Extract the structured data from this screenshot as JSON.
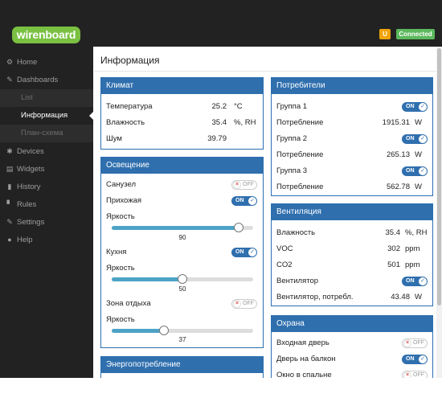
{
  "brand": {
    "logo": "wirenboard"
  },
  "status": {
    "user_badge": "U",
    "connection": "Connected"
  },
  "sidebar": {
    "items": [
      {
        "label": "Home",
        "icon": "home-icon"
      },
      {
        "label": "Dashboards",
        "icon": "wrench-icon"
      },
      {
        "label": "List",
        "sub": true
      },
      {
        "label": "Информация",
        "sub": true,
        "active": true
      },
      {
        "label": "План-схема",
        "sub": true
      },
      {
        "label": "Devices",
        "icon": "gear-icon"
      },
      {
        "label": "Widgets",
        "icon": "widgets-icon"
      },
      {
        "label": "History",
        "icon": "bar-chart-icon"
      },
      {
        "label": "Rules",
        "icon": "file-icon"
      },
      {
        "label": "Settings",
        "icon": "wrench-icon"
      },
      {
        "label": "Help",
        "icon": "question-icon"
      }
    ]
  },
  "page": {
    "title": "Информация"
  },
  "climate": {
    "title": "Климат",
    "rows": [
      {
        "label": "Температура",
        "value": "25.2",
        "unit": "°C"
      },
      {
        "label": "Влажность",
        "value": "35.4",
        "unit": "%, RH"
      },
      {
        "label": "Шум",
        "value": "39.79",
        "unit": ""
      }
    ]
  },
  "lighting": {
    "title": "Освещение",
    "sanuzel": {
      "label": "Санузел",
      "state": "OFF"
    },
    "prihozhaya": {
      "label": "Прихожая",
      "state": "ON"
    },
    "brightness1": {
      "label": "Яркость",
      "value": "90"
    },
    "kuhnya": {
      "label": "Кухня",
      "state": "ON"
    },
    "brightness2": {
      "label": "Яркость",
      "value": "50"
    },
    "zona": {
      "label": "Зона отдыха",
      "state": "OFF"
    },
    "brightness3": {
      "label": "Яркость",
      "value": "37"
    }
  },
  "energy": {
    "title": "Энергопотребление"
  },
  "consumers": {
    "title": "Потребители",
    "g1": {
      "label": "Группа 1",
      "state": "ON"
    },
    "p1": {
      "label": "Потребление",
      "value": "1915.31",
      "unit": "W"
    },
    "g2": {
      "label": "Группа 2",
      "state": "ON"
    },
    "p2": {
      "label": "Потребление",
      "value": "265.13",
      "unit": "W"
    },
    "g3": {
      "label": "Группа 3",
      "state": "ON"
    },
    "p3": {
      "label": "Потребление",
      "value": "562.78",
      "unit": "W"
    }
  },
  "ventilation": {
    "title": "Вентиляция",
    "hum": {
      "label": "Влажность",
      "value": "35.4",
      "unit": "%, RH"
    },
    "voc": {
      "label": "VOC",
      "value": "302",
      "unit": "ppm"
    },
    "co2": {
      "label": "CO2",
      "value": "501",
      "unit": "ppm"
    },
    "fan": {
      "label": "Вентилятор",
      "state": "ON"
    },
    "fanp": {
      "label": "Вентилятор, потребл.",
      "value": "43.48",
      "unit": "W"
    }
  },
  "security": {
    "title": "Охрана",
    "d1": {
      "label": "Входная дверь",
      "state": "OFF"
    },
    "d2": {
      "label": "Дверь на балкон",
      "state": "ON"
    },
    "d3": {
      "label": "Окно в спальне",
      "state": "OFF"
    }
  },
  "colors": {
    "panel_header": "#2f6fae",
    "sidebar": "#222222",
    "logo": "#7ac142",
    "connected": "#5cb85c",
    "slider_fill": "#4da3c6"
  }
}
